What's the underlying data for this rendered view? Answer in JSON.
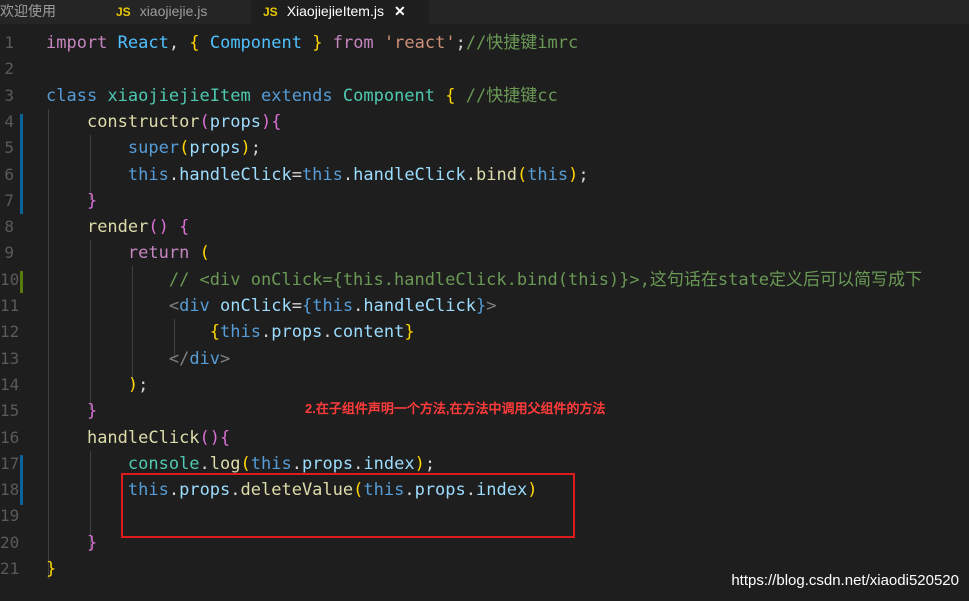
{
  "tabs": [
    {
      "label": "欢迎使用",
      "icon": "",
      "active": false
    },
    {
      "label": "xiaojiejie.js",
      "icon": "JS",
      "active": false
    },
    {
      "label": "XiaojiejieItem.js",
      "icon": "JS",
      "active": true,
      "close": "✕"
    }
  ],
  "lines": [
    {
      "n": "1",
      "tokens": [
        [
          "k",
          "import"
        ],
        [
          "p",
          " "
        ],
        [
          "id",
          "React"
        ],
        [
          "p",
          ", "
        ],
        [
          "br",
          "{"
        ],
        [
          "p",
          " "
        ],
        [
          "id",
          "Component"
        ],
        [
          "p",
          " "
        ],
        [
          "br",
          "}"
        ],
        [
          "p",
          " "
        ],
        [
          "k",
          "from"
        ],
        [
          "p",
          " "
        ],
        [
          "s",
          "'react'"
        ],
        [
          "p",
          ";"
        ],
        [
          "c",
          "//快捷键imrc"
        ]
      ]
    },
    {
      "n": "2",
      "tokens": []
    },
    {
      "n": "3",
      "tokens": [
        [
          "kw",
          "class"
        ],
        [
          "p",
          " "
        ],
        [
          "t",
          "xiaojiejieItem"
        ],
        [
          "p",
          " "
        ],
        [
          "kw",
          "extends"
        ],
        [
          "p",
          " "
        ],
        [
          "t",
          "Component"
        ],
        [
          "p",
          " "
        ],
        [
          "br",
          "{"
        ],
        [
          "p",
          " "
        ],
        [
          "c",
          "//快捷键cc"
        ]
      ]
    },
    {
      "n": "4",
      "tokens": [
        [
          "p",
          "    "
        ],
        [
          "f",
          "constructor"
        ],
        [
          "br2",
          "("
        ],
        [
          "attr",
          "props"
        ],
        [
          "br2",
          ")"
        ],
        [
          "br2",
          "{"
        ]
      ]
    },
    {
      "n": "5",
      "tokens": [
        [
          "p",
          "        "
        ],
        [
          "kw",
          "super"
        ],
        [
          "br",
          "("
        ],
        [
          "attr",
          "props"
        ],
        [
          "br",
          ")"
        ],
        [
          "p",
          ";"
        ]
      ]
    },
    {
      "n": "6",
      "tokens": [
        [
          "p",
          "        "
        ],
        [
          "kw",
          "this"
        ],
        [
          "p",
          "."
        ],
        [
          "attr",
          "handleClick"
        ],
        [
          "p",
          "="
        ],
        [
          "kw",
          "this"
        ],
        [
          "p",
          "."
        ],
        [
          "attr",
          "handleClick"
        ],
        [
          "p",
          "."
        ],
        [
          "f",
          "bind"
        ],
        [
          "br",
          "("
        ],
        [
          "kw",
          "this"
        ],
        [
          "br",
          ")"
        ],
        [
          "p",
          ";"
        ]
      ]
    },
    {
      "n": "7",
      "tokens": [
        [
          "p",
          "    "
        ],
        [
          "br2",
          "}"
        ]
      ]
    },
    {
      "n": "8",
      "tokens": [
        [
          "p",
          "    "
        ],
        [
          "f",
          "render"
        ],
        [
          "br2",
          "()"
        ],
        [
          "p",
          " "
        ],
        [
          "br2",
          "{"
        ]
      ]
    },
    {
      "n": "9",
      "tokens": [
        [
          "p",
          "        "
        ],
        [
          "k",
          "return"
        ],
        [
          "p",
          " "
        ],
        [
          "br",
          "("
        ]
      ]
    },
    {
      "n": "10",
      "tokens": [
        [
          "p",
          "            "
        ],
        [
          "c",
          "// <div onClick={this.handleClick.bind(this)}>,这句话在state定义后可以简写成下"
        ]
      ]
    },
    {
      "n": "11",
      "tokens": [
        [
          "p",
          "            "
        ],
        [
          "tag",
          "<"
        ],
        [
          "tagn",
          "div"
        ],
        [
          "p",
          " "
        ],
        [
          "attr",
          "onClick"
        ],
        [
          "p",
          "="
        ],
        [
          "kw",
          "{"
        ],
        [
          "kw",
          "this"
        ],
        [
          "p",
          "."
        ],
        [
          "attr",
          "handleClick"
        ],
        [
          "kw",
          "}"
        ],
        [
          "tag",
          ">"
        ]
      ]
    },
    {
      "n": "12",
      "tokens": [
        [
          "p",
          "                "
        ],
        [
          "br",
          "{"
        ],
        [
          "kw",
          "this"
        ],
        [
          "p",
          "."
        ],
        [
          "attr",
          "props"
        ],
        [
          "p",
          "."
        ],
        [
          "attr",
          "content"
        ],
        [
          "br",
          "}"
        ]
      ]
    },
    {
      "n": "13",
      "tokens": [
        [
          "p",
          "            "
        ],
        [
          "tag",
          "</"
        ],
        [
          "tagn",
          "div"
        ],
        [
          "tag",
          ">"
        ]
      ]
    },
    {
      "n": "14",
      "tokens": [
        [
          "p",
          "        "
        ],
        [
          "br",
          ")"
        ],
        [
          "p",
          ";"
        ]
      ]
    },
    {
      "n": "15",
      "tokens": [
        [
          "p",
          "    "
        ],
        [
          "br2",
          "}"
        ]
      ]
    },
    {
      "n": "16",
      "tokens": [
        [
          "p",
          "    "
        ],
        [
          "f",
          "handleClick"
        ],
        [
          "br2",
          "()"
        ],
        [
          "br2",
          "{"
        ]
      ]
    },
    {
      "n": "17",
      "tokens": [
        [
          "p",
          "        "
        ],
        [
          "t",
          "console"
        ],
        [
          "p",
          "."
        ],
        [
          "f",
          "log"
        ],
        [
          "br",
          "("
        ],
        [
          "kw",
          "this"
        ],
        [
          "p",
          "."
        ],
        [
          "attr",
          "props"
        ],
        [
          "p",
          "."
        ],
        [
          "attr",
          "index"
        ],
        [
          "br",
          ")"
        ],
        [
          "p",
          ";"
        ]
      ]
    },
    {
      "n": "18",
      "tokens": [
        [
          "p",
          "        "
        ],
        [
          "kw",
          "this"
        ],
        [
          "p",
          "."
        ],
        [
          "attr",
          "props"
        ],
        [
          "p",
          "."
        ],
        [
          "f",
          "deleteValue"
        ],
        [
          "br",
          "("
        ],
        [
          "kw",
          "this"
        ],
        [
          "p",
          "."
        ],
        [
          "attr",
          "props"
        ],
        [
          "p",
          "."
        ],
        [
          "attr",
          "index"
        ],
        [
          "br",
          ")"
        ]
      ]
    },
    {
      "n": "19",
      "tokens": []
    },
    {
      "n": "20",
      "tokens": [
        [
          "p",
          "    "
        ],
        [
          "br2",
          "}"
        ]
      ]
    },
    {
      "n": "21",
      "tokens": [
        [
          "br",
          "}"
        ]
      ]
    }
  ],
  "annotation": "2.在子组件声明一个方法,在方法中调用父组件的方法",
  "watermark": "https://blog.csdn.net/xiaodi520520",
  "colors": {
    "added_marker": "#0e639c",
    "modified_marker": "#587c0c",
    "highlight_box": "#e0191d"
  }
}
